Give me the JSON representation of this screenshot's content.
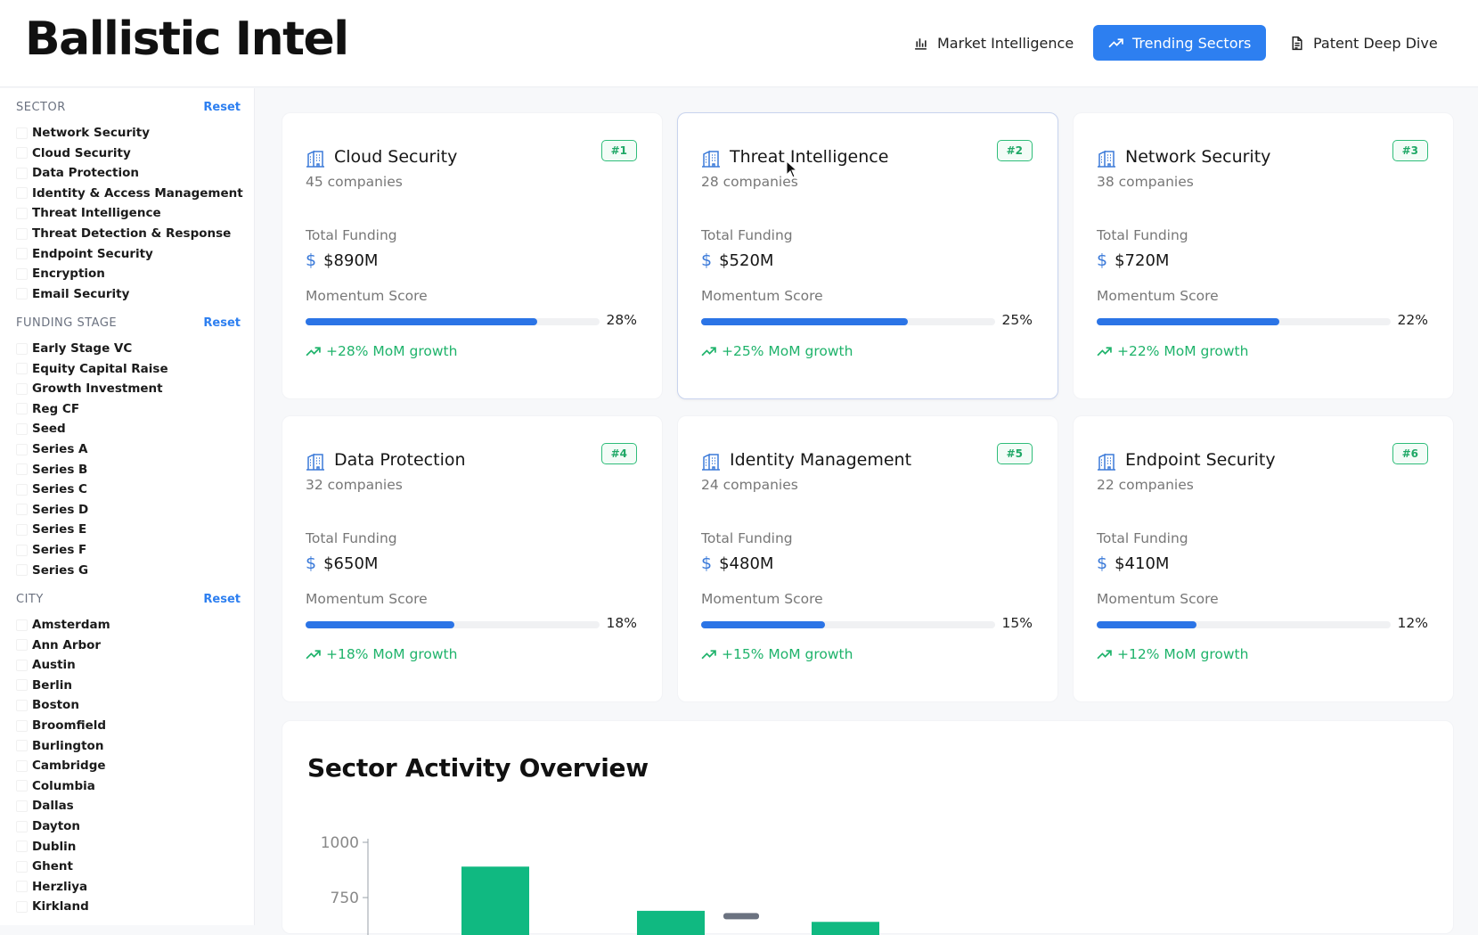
{
  "app": {
    "title": "Ballistic Intel"
  },
  "nav": [
    {
      "label": "Market Intelligence",
      "icon": "bar-chart-icon",
      "active": false
    },
    {
      "label": "Trending Sectors",
      "icon": "trending-up-icon",
      "active": true
    },
    {
      "label": "Patent Deep Dive",
      "icon": "document-icon",
      "active": false
    }
  ],
  "filters": {
    "sector": {
      "heading": "SECTOR",
      "reset": "Reset",
      "options": [
        "Network Security",
        "Cloud Security",
        "Data Protection",
        "Identity & Access Management",
        "Threat Intelligence",
        "Threat Detection & Response",
        "Endpoint Security",
        "Encryption",
        "Email Security"
      ]
    },
    "funding_stage": {
      "heading": "FUNDING STAGE",
      "reset": "Reset",
      "options": [
        "Early Stage VC",
        "Equity Capital Raise",
        "Growth Investment",
        "Reg CF",
        "Seed",
        "Series A",
        "Series B",
        "Series C",
        "Series D",
        "Series E",
        "Series F",
        "Series G"
      ]
    },
    "city": {
      "heading": "CITY",
      "reset": "Reset",
      "options": [
        "Amsterdam",
        "Ann Arbor",
        "Austin",
        "Berlin",
        "Boston",
        "Broomfield",
        "Burlington",
        "Cambridge",
        "Columbia",
        "Dallas",
        "Dayton",
        "Dublin",
        "Ghent",
        "Herzliya",
        "Kirkland"
      ]
    }
  },
  "labels": {
    "total_funding": "Total Funding",
    "momentum_score": "Momentum Score",
    "currency_symbol": "$"
  },
  "sectors": [
    {
      "rank": "#1",
      "name": "Cloud Security",
      "companies": "45 companies",
      "funding": "$890M",
      "momentum": 28,
      "momentum_label": "28%",
      "growth": "+28% MoM growth"
    },
    {
      "rank": "#2",
      "name": "Threat Intelligence",
      "companies": "28 companies",
      "funding": "$520M",
      "momentum": 25,
      "momentum_label": "25%",
      "growth": "+25% MoM growth"
    },
    {
      "rank": "#3",
      "name": "Network Security",
      "companies": "38 companies",
      "funding": "$720M",
      "momentum": 22,
      "momentum_label": "22%",
      "growth": "+22% MoM growth"
    },
    {
      "rank": "#4",
      "name": "Data Protection",
      "companies": "32 companies",
      "funding": "$650M",
      "momentum": 18,
      "momentum_label": "18%",
      "growth": "+18% MoM growth"
    },
    {
      "rank": "#5",
      "name": "Identity Management",
      "companies": "24 companies",
      "funding": "$480M",
      "momentum": 15,
      "momentum_label": "15%",
      "growth": "+15% MoM growth"
    },
    {
      "rank": "#6",
      "name": "Endpoint Security",
      "companies": "22 companies",
      "funding": "$410M",
      "momentum": 12,
      "momentum_label": "12%",
      "growth": "+12% MoM growth"
    }
  ],
  "overview": {
    "title": "Sector Activity Overview",
    "chart_data": {
      "type": "bar",
      "title": "",
      "ylabel": "",
      "yticks": [
        "1000",
        "750"
      ],
      "ylim": [
        0,
        1000
      ],
      "visible_bars": [
        {
          "value": 890,
          "color": "#10b981"
        },
        {
          "value": 690,
          "color": "#10b981"
        },
        {
          "value": 680,
          "color": "#6b7280"
        },
        {
          "value": 640,
          "color": "#10b981"
        }
      ]
    }
  },
  "colors": {
    "accent": "#2d7ff0",
    "growth": "#1fb36b",
    "bar_green": "#10b981",
    "bar_gray": "#6b7280"
  }
}
